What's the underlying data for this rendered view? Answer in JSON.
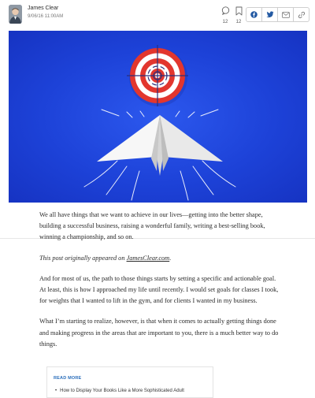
{
  "header": {
    "author_name": "James Clear",
    "post_date": "9/06/16 11:00AM",
    "comments_count": "12",
    "bookmarks_count": "12",
    "share_buttons": [
      "facebook-icon",
      "twitter-icon",
      "email-icon",
      "link-icon"
    ]
  },
  "hero": {
    "icons": [
      "target-icon",
      "paper-plane-icon"
    ],
    "colors": {
      "background": "#1d42d8",
      "target_red": "#e2362e",
      "plane": "#f4f4f4"
    }
  },
  "article": {
    "p1": "We all have things that we want to achieve in our lives—getting into the better shape, building a successful business, raising a wonderful family, writing a best-selling book, winning a championship, and so on.",
    "p2_prefix": "This post originally appeared on ",
    "p2_link": "JamesClear.com",
    "p2_suffix": ".",
    "p3": "And for most of us, the path to those things starts by setting a specific and actionable goal. At least, this is how I approached my life until recently. I would set goals for classes I took, for weights that I wanted to lift in the gym, and for clients I wanted in my business.",
    "p4": "What I’m starting to realize, however, is that when it comes to actually getting things done and making progress in the areas that are important to you, there is a much better way to do things."
  },
  "read_more": {
    "title": "READ MORE",
    "items": [
      "How to Display Your Books Like a More Sophisticated Adult"
    ]
  }
}
